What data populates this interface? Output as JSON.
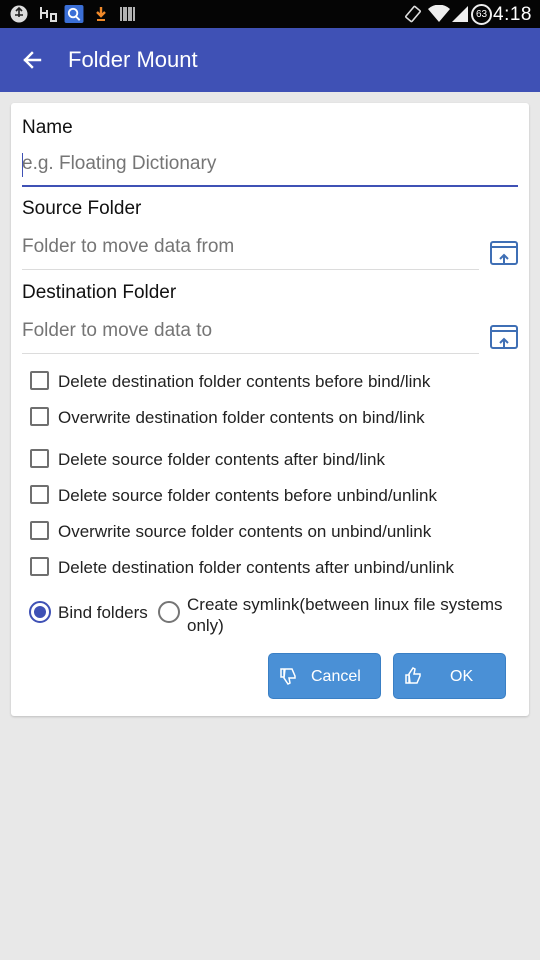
{
  "status_bar": {
    "time": "4:18",
    "battery_level": "63",
    "icons": [
      "usb-icon",
      "usb-debug-icon",
      "search-notify-icon",
      "download-icon",
      "barcode-icon",
      "rotate-icon",
      "wifi-icon",
      "signal-icon",
      "battery-icon"
    ]
  },
  "app_bar": {
    "title": "Folder Mount",
    "back_icon": "arrow-back-icon"
  },
  "form": {
    "name_label": "Name",
    "name_placeholder": "e.g. Floating Dictionary",
    "source_label": "Source Folder",
    "source_placeholder": "Folder to move data from",
    "destination_label": "Destination Folder",
    "destination_placeholder": "Folder to move data to",
    "picker_icon": "folder-picker-icon"
  },
  "options": [
    {
      "label": "Delete destination folder contents before bind/link",
      "checked": false
    },
    {
      "label": "Overwrite destination folder contents on bind/link",
      "checked": false
    },
    {
      "label": "Delete source folder contents after bind/link",
      "checked": false
    },
    {
      "label": "Delete source folder contents before unbind/unlink",
      "checked": false
    },
    {
      "label": "Overwrite source folder contents on unbind/unlink",
      "checked": false
    },
    {
      "label": "Delete destination folder contents after unbind/unlink",
      "checked": false
    }
  ],
  "mode": {
    "bind_label": "Bind folders",
    "symlink_label": "Create symlink(between linux file systems only)",
    "selected": "Bind folders"
  },
  "buttons": {
    "cancel_label": "Cancel",
    "ok_label": "OK"
  },
  "colors": {
    "primary": "#3f51b5",
    "button": "#4a90d6",
    "background": "#e8e8e8"
  }
}
